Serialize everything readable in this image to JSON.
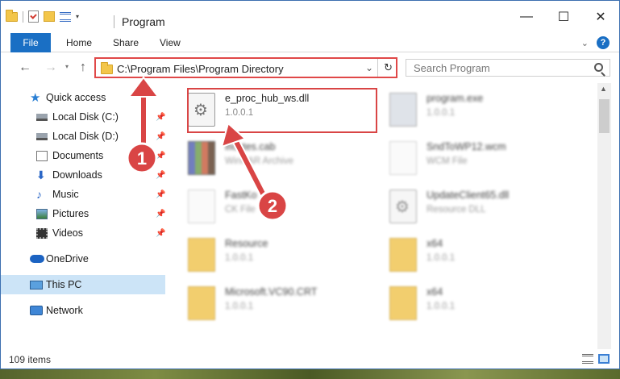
{
  "window": {
    "title": "Program"
  },
  "ribbon": {
    "tabs": [
      "File",
      "Home",
      "Share",
      "View"
    ]
  },
  "address": {
    "path": "C:\\Program Files\\Program Directory"
  },
  "search": {
    "placeholder": "Search Program"
  },
  "nav": {
    "items": [
      {
        "label": "Quick access",
        "icon": "star-icon"
      },
      {
        "label": "Local Disk (C:)",
        "icon": "disk-icon",
        "pinned": true
      },
      {
        "label": "Local Disk (D:)",
        "icon": "disk-icon",
        "pinned": true
      },
      {
        "label": "Documents",
        "icon": "documents-icon",
        "pinned": true
      },
      {
        "label": "Downloads",
        "icon": "downloads-icon",
        "pinned": true
      },
      {
        "label": "Music",
        "icon": "music-icon",
        "pinned": true
      },
      {
        "label": "Pictures",
        "icon": "pictures-icon",
        "pinned": true
      },
      {
        "label": "Videos",
        "icon": "videos-icon",
        "pinned": true
      },
      {
        "label": "OneDrive",
        "icon": "onedrive-icon"
      },
      {
        "label": "This PC",
        "icon": "this-pc-icon",
        "selected": true
      },
      {
        "label": "Network",
        "icon": "network-icon"
      }
    ]
  },
  "files": [
    {
      "name": "e_proc_hub_ws.dll",
      "sub": "1.0.0.1",
      "icon": "dll-icon",
      "highlighted": true
    },
    {
      "name": "program.exe",
      "sub": "1.0.0.1",
      "icon": "exe-icon"
    },
    {
      "name": "ificates.cab",
      "sub": "WinRAR Archive",
      "icon": "cab-icon"
    },
    {
      "name": "SndToWP12.wcm",
      "sub": "WCM File",
      "icon": "generic-file-icon"
    },
    {
      "name": "FastKo",
      "sub": "CK File",
      "icon": "generic-file-icon"
    },
    {
      "name": "UpdateClient65.dll",
      "sub": "Resource DLL",
      "icon": "dll-icon"
    },
    {
      "name": "Resource",
      "sub": "1.0.0.1",
      "icon": "folder-icon"
    },
    {
      "name": "x64",
      "sub": "1.0.0.1",
      "icon": "folder-icon"
    },
    {
      "name": "Microsoft.VC90.CRT",
      "sub": "1.0.0.1",
      "icon": "folder-icon"
    },
    {
      "name": "x64",
      "sub": "1.0.0.1",
      "icon": "folder-icon"
    }
  ],
  "status": {
    "count": "109 items"
  },
  "annotations": {
    "step1": "1",
    "step2": "2",
    "color": "#d94545"
  },
  "colors": {
    "accent": "#1a6fc4",
    "highlight": "#d94545",
    "selected": "#cce4f7"
  }
}
